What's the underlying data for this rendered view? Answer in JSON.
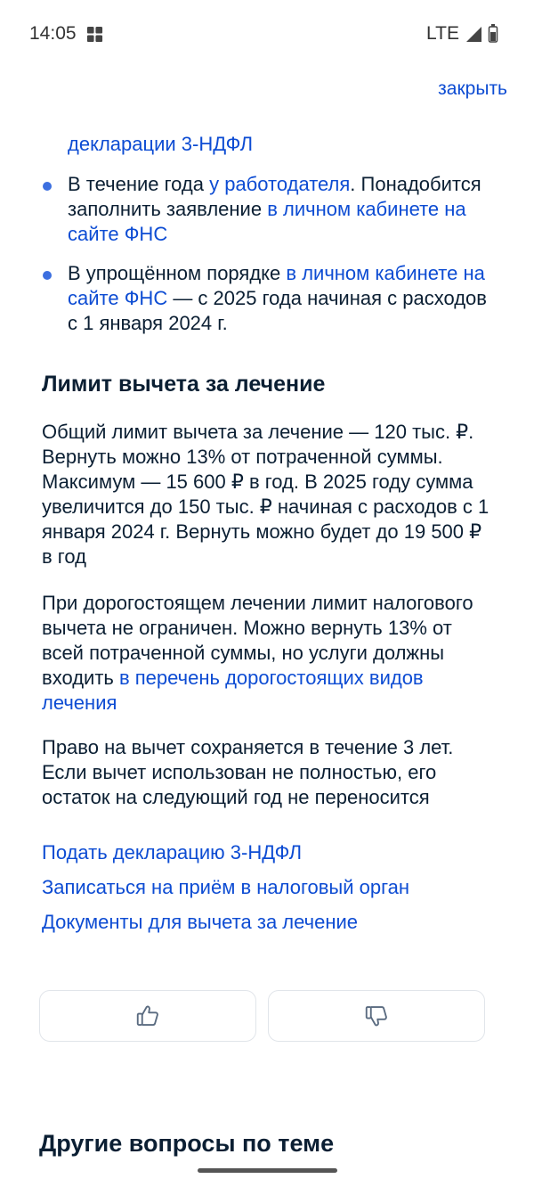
{
  "status_bar": {
    "time": "14:05",
    "network": "LTE"
  },
  "header": {
    "close_label": "закрыть"
  },
  "bullets": {
    "partial_text": "декларации 3-НДФЛ",
    "item2": {
      "t1": "В течение года ",
      "l1": "у работодателя",
      "t2": ". Понадобится заполнить заявление ",
      "l2": "в личном кабинете на сайте ФНС"
    },
    "item3": {
      "t1": "В упрощённом порядке ",
      "l1": "в личном кабинете на сайте ФНС",
      "t2": " — с 2025 года начиная с расходов с 1 января 2024 г."
    }
  },
  "limit_section": {
    "title": "Лимит вычета за лечение",
    "para1": "Общий лимит вычета за лечение — 120 тыс. ₽. Вернуть можно 13% от потраченной суммы. Максимум — 15 600 ₽ в год. В 2025 году сумма увеличится до 150 тыс. ₽ начиная с расходов с 1 января 2024 г. Вернуть можно будет до 19 500 ₽ в год",
    "para2_text": "При дорогостоящем лечении лимит налогового вычета не ограничен. Можно вернуть 13% от всей потраченной суммы, но услуги должны входить ",
    "para2_link": "в перечень дорогостоящих видов лечения",
    "para3": "Право на вычет сохраняется в течение 3 лет. Если вычет использован не полностью, его остаток на следующий год не переносится"
  },
  "links": [
    "Подать декларацию 3-НДФЛ",
    "Записаться на приём в налоговый орган",
    "Документы для вычета за лечение"
  ],
  "feedback": {
    "like_icon": "thumbs-up-icon",
    "dislike_icon": "thumbs-down-icon"
  },
  "other_questions": {
    "title": "Другие вопросы по теме"
  },
  "colors": {
    "link": "#0d4cd3",
    "bullet": "#3c6fe0",
    "text": "#0b1f33"
  }
}
